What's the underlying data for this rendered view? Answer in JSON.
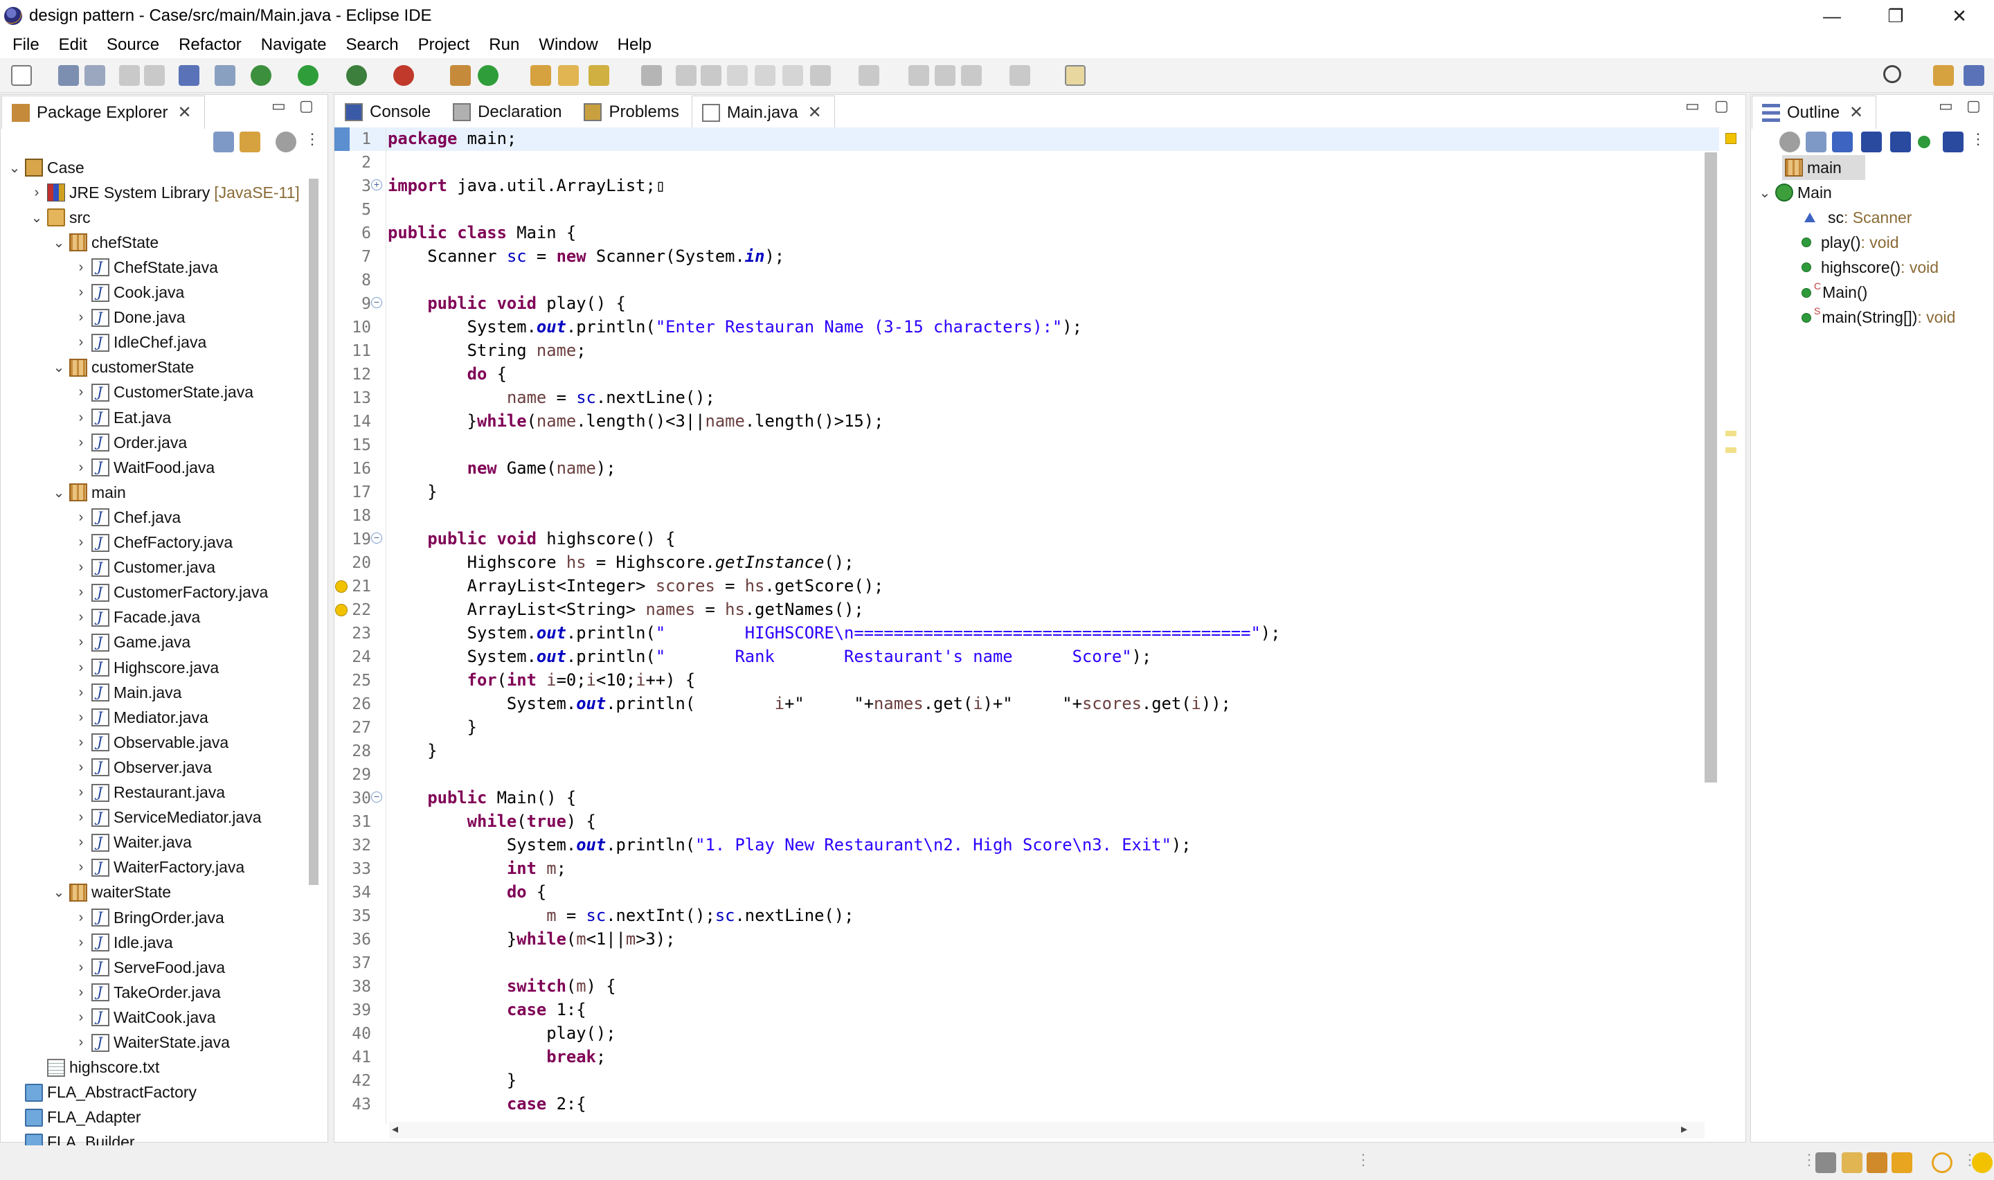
{
  "window": {
    "title": "design pattern - Case/src/main/Main.java - Eclipse IDE",
    "minimize": "—",
    "restore": "❐",
    "close": "✕"
  },
  "menu": [
    "File",
    "Edit",
    "Source",
    "Refactor",
    "Navigate",
    "Search",
    "Project",
    "Run",
    "Window",
    "Help"
  ],
  "package_explorer": {
    "tab_label": "Package Explorer",
    "tree": [
      {
        "label": "Case",
        "depth": 0,
        "icon": "project-icon",
        "chev": "v"
      },
      {
        "label": "JRE System Library",
        "extra": "[JavaSE-11]",
        "depth": 1,
        "icon": "library-icon",
        "chev": ">"
      },
      {
        "label": "src",
        "depth": 1,
        "icon": "source-folder-icon",
        "chev": "v"
      },
      {
        "label": "chefState",
        "depth": 2,
        "icon": "package-icon",
        "chev": "v"
      },
      {
        "label": "ChefState.java",
        "depth": 3,
        "icon": "java-file-icon",
        "chev": ">"
      },
      {
        "label": "Cook.java",
        "depth": 3,
        "icon": "java-file-icon",
        "chev": ">"
      },
      {
        "label": "Done.java",
        "depth": 3,
        "icon": "java-file-icon",
        "chev": ">"
      },
      {
        "label": "IdleChef.java",
        "depth": 3,
        "icon": "java-file-icon",
        "chev": ">"
      },
      {
        "label": "customerState",
        "depth": 2,
        "icon": "package-icon",
        "chev": "v"
      },
      {
        "label": "CustomerState.java",
        "depth": 3,
        "icon": "java-file-icon",
        "chev": ">"
      },
      {
        "label": "Eat.java",
        "depth": 3,
        "icon": "java-file-icon",
        "chev": ">"
      },
      {
        "label": "Order.java",
        "depth": 3,
        "icon": "java-file-icon",
        "chev": ">"
      },
      {
        "label": "WaitFood.java",
        "depth": 3,
        "icon": "java-file-icon",
        "chev": ">"
      },
      {
        "label": "main",
        "depth": 2,
        "icon": "package-icon",
        "chev": "v"
      },
      {
        "label": "Chef.java",
        "depth": 3,
        "icon": "java-file-icon",
        "chev": ">"
      },
      {
        "label": "ChefFactory.java",
        "depth": 3,
        "icon": "java-file-icon",
        "chev": ">"
      },
      {
        "label": "Customer.java",
        "depth": 3,
        "icon": "java-file-icon",
        "chev": ">"
      },
      {
        "label": "CustomerFactory.java",
        "depth": 3,
        "icon": "java-file-icon",
        "chev": ">"
      },
      {
        "label": "Facade.java",
        "depth": 3,
        "icon": "java-file-icon",
        "chev": ">"
      },
      {
        "label": "Game.java",
        "depth": 3,
        "icon": "java-file-icon",
        "chev": ">"
      },
      {
        "label": "Highscore.java",
        "depth": 3,
        "icon": "java-file-icon",
        "chev": ">"
      },
      {
        "label": "Main.java",
        "depth": 3,
        "icon": "java-file-icon",
        "chev": ">"
      },
      {
        "label": "Mediator.java",
        "depth": 3,
        "icon": "java-file-icon",
        "chev": ">"
      },
      {
        "label": "Observable.java",
        "depth": 3,
        "icon": "java-file-icon",
        "chev": ">"
      },
      {
        "label": "Observer.java",
        "depth": 3,
        "icon": "java-file-icon",
        "chev": ">"
      },
      {
        "label": "Restaurant.java",
        "depth": 3,
        "icon": "java-file-icon",
        "chev": ">"
      },
      {
        "label": "ServiceMediator.java",
        "depth": 3,
        "icon": "java-file-icon",
        "chev": ">"
      },
      {
        "label": "Waiter.java",
        "depth": 3,
        "icon": "java-file-icon",
        "chev": ">"
      },
      {
        "label": "WaiterFactory.java",
        "depth": 3,
        "icon": "java-file-icon",
        "chev": ">"
      },
      {
        "label": "waiterState",
        "depth": 2,
        "icon": "package-icon",
        "chev": "v"
      },
      {
        "label": "BringOrder.java",
        "depth": 3,
        "icon": "java-file-icon",
        "chev": ">"
      },
      {
        "label": "Idle.java",
        "depth": 3,
        "icon": "java-file-icon",
        "chev": ">"
      },
      {
        "label": "ServeFood.java",
        "depth": 3,
        "icon": "java-file-icon",
        "chev": ">"
      },
      {
        "label": "TakeOrder.java",
        "depth": 3,
        "icon": "java-file-icon",
        "chev": ">"
      },
      {
        "label": "WaitCook.java",
        "depth": 3,
        "icon": "java-file-icon",
        "chev": ">"
      },
      {
        "label": "WaiterState.java",
        "depth": 3,
        "icon": "java-file-icon",
        "chev": ">"
      },
      {
        "label": "highscore.txt",
        "depth": 1,
        "icon": "text-file-icon",
        "chev": ""
      },
      {
        "label": "FLA_AbstractFactory",
        "depth": 0,
        "icon": "closed-project-icon",
        "chev": ""
      },
      {
        "label": "FLA_Adapter",
        "depth": 0,
        "icon": "closed-project-icon",
        "chev": ""
      },
      {
        "label": "FLA_Builder",
        "depth": 0,
        "icon": "closed-project-icon",
        "chev": ""
      }
    ]
  },
  "editor_tabs": [
    {
      "label": "Console",
      "icon": "console-icon",
      "active": false
    },
    {
      "label": "Declaration",
      "icon": "declaration-icon",
      "active": false
    },
    {
      "label": "Problems",
      "icon": "problems-icon",
      "active": false
    },
    {
      "label": "Main.java",
      "icon": "java-file-icon",
      "active": true,
      "closable": true
    }
  ],
  "code": [
    {
      "n": "1",
      "t": "[[kw:package]] main;"
    },
    {
      "n": "2",
      "t": ""
    },
    {
      "n": "3",
      "t": "[[kw:import]] java.util.ArrayList;▯",
      "fold": "+"
    },
    {
      "n": "5",
      "t": ""
    },
    {
      "n": "6",
      "t": "[[kw:public]] [[kw:class]] Main {"
    },
    {
      "n": "7",
      "t": "    Scanner [[fld:sc]] = [[kw:new]] Scanner(System.[[sfld:in]]);"
    },
    {
      "n": "8",
      "t": ""
    },
    {
      "n": "9",
      "t": "    [[kw:public]] [[kw:void]] play() {",
      "fold": "-"
    },
    {
      "n": "10",
      "t": "        System.[[sfld:out]].println([[str:\"Enter Restauran Name (3-15 characters):\"]]);"
    },
    {
      "n": "11",
      "t": "        String [[loc:name]];"
    },
    {
      "n": "12",
      "t": "        [[kw:do]] {"
    },
    {
      "n": "13",
      "t": "            [[loc:name]] = [[fld:sc]].nextLine();"
    },
    {
      "n": "14",
      "t": "        }[[kw:while]]([[loc:name]].length()<3||[[loc:name]].length()>15);"
    },
    {
      "n": "15",
      "t": ""
    },
    {
      "n": "16",
      "t": "        [[kw:new]] Game([[loc:name]]);"
    },
    {
      "n": "17",
      "t": "    }"
    },
    {
      "n": "18",
      "t": ""
    },
    {
      "n": "19",
      "t": "    [[kw:public]] [[kw:void]] highscore() {",
      "fold": "-"
    },
    {
      "n": "20",
      "t": "        Highscore [[loc:hs]] = Highscore.[[smeth:getInstance]]();"
    },
    {
      "n": "21",
      "t": "        ArrayList<Integer> [[loc:scores]] = [[loc:hs]].getScore();",
      "warn": true
    },
    {
      "n": "22",
      "t": "        ArrayList<String> [[loc:names]] = [[loc:hs]].getNames();",
      "warn": true
    },
    {
      "n": "23",
      "t": "        System.[[sfld:out]].println([[str:\"        HIGHSCORE\\n========================================\"]]);"
    },
    {
      "n": "24",
      "t": "        System.[[sfld:out]].println([[str:\"       Rank       Restaurant's name      Score\"]]);"
    },
    {
      "n": "25",
      "t": "        [[kw:for]]([[kw:int]] [[loc:i]]=0;[[loc:i]]<10;[[loc:i]]++) {"
    },
    {
      "n": "26",
      "t": "            System.[[sfld:out]].println(        [[loc:i]]+\"     \"+[[loc:names]].get([[loc:i]])+\"     \"+[[loc:scores]].get([[loc:i]]));"
    },
    {
      "n": "27",
      "t": "        }"
    },
    {
      "n": "28",
      "t": "    }"
    },
    {
      "n": "29",
      "t": ""
    },
    {
      "n": "30",
      "t": "    [[kw:public]] Main() {",
      "fold": "-"
    },
    {
      "n": "31",
      "t": "        [[kw:while]]([[kw:true]]) {"
    },
    {
      "n": "32",
      "t": "            System.[[sfld:out]].println([[str:\"1. Play New Restaurant\\n2. High Score\\n3. Exit\"]]);"
    },
    {
      "n": "33",
      "t": "            [[kw:int]] [[loc:m]];"
    },
    {
      "n": "34",
      "t": "            [[kw:do]] {"
    },
    {
      "n": "35",
      "t": "                [[loc:m]] = [[fld:sc]].nextInt();[[fld:sc]].nextLine();"
    },
    {
      "n": "36",
      "t": "            }[[kw:while]]([[loc:m]]<1||[[loc:m]]>3);"
    },
    {
      "n": "37",
      "t": ""
    },
    {
      "n": "38",
      "t": "            [[kw:switch]]([[loc:m]]) {"
    },
    {
      "n": "39",
      "t": "            [[kw:case]] 1:{"
    },
    {
      "n": "40",
      "t": "                play();"
    },
    {
      "n": "41",
      "t": "                [[kw:break]];"
    },
    {
      "n": "42",
      "t": "            }"
    },
    {
      "n": "43",
      "t": "            [[kw:case]] 2:{"
    }
  ],
  "outline": {
    "tab_label": "Outline",
    "items": [
      {
        "label": "main",
        "type": "",
        "depth": 0,
        "icon": "package-decl-icon",
        "chev": "",
        "selected": true
      },
      {
        "label": "Main",
        "type": "",
        "depth": 0,
        "icon": "class-icon",
        "chev": "v"
      },
      {
        "label": "sc",
        "type": " : Scanner",
        "depth": 1,
        "icon": "field-default-icon"
      },
      {
        "label": "play()",
        "type": " : void",
        "depth": 1,
        "icon": "method-public-icon"
      },
      {
        "label": "highscore()",
        "type": " : void",
        "depth": 1,
        "icon": "method-public-icon"
      },
      {
        "label": "Main()",
        "type": "",
        "depth": 1,
        "icon": "constructor-icon",
        "mark": "c"
      },
      {
        "label": "main(String[])",
        "type": " : void",
        "depth": 1,
        "icon": "static-method-icon",
        "mark": "s"
      }
    ]
  },
  "colors": {
    "keyword": "#7f0055",
    "string": "#2a00ff",
    "field": "#0000c0",
    "local": "#6a3e3e"
  }
}
